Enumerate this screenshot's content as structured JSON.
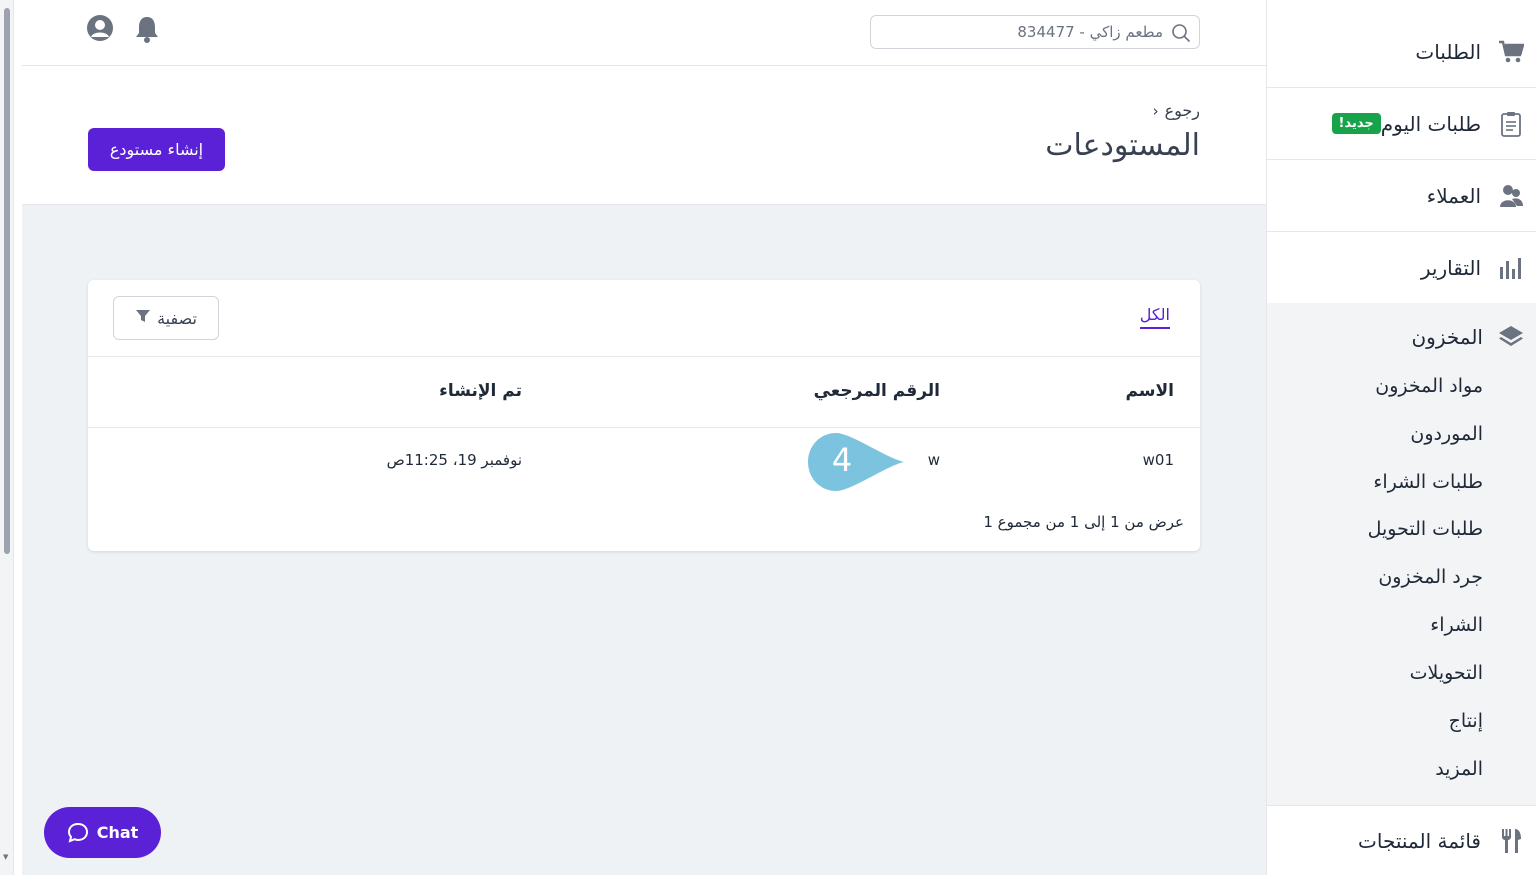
{
  "topbar": {
    "search_placeholder": "مطعم زاكي - 834477",
    "search_icon": "search-icon",
    "bell_icon": "bell-icon",
    "user_icon": "user-circle-icon"
  },
  "header": {
    "back_label": "رجوع",
    "title": "المستودعات",
    "create_button": "إنشاء مستودع"
  },
  "card": {
    "tab_all": "الكل",
    "filter_label": "تصفية",
    "columns": {
      "name": "الاسم",
      "ref": "الرقم المرجعي",
      "created": "تم الإنشاء"
    },
    "rows": [
      {
        "name": "w01",
        "ref": "w",
        "created": "نوفمبر 19، 11:25ص"
      }
    ],
    "pagination": "عرض من 1 إلى 1 من مجموع 1"
  },
  "bubble": {
    "number": "4",
    "color": "#7cc3df"
  },
  "chat": {
    "label": "Chat"
  },
  "sidebar": {
    "orders": "الطلبات",
    "today_orders": "طلبات اليوم",
    "new_badge": "جديد!",
    "customers": "العملاء",
    "reports": "التقارير",
    "inventory": "المخزون",
    "inventory_items": [
      "مواد المخزون",
      "الموردون",
      "طلبات الشراء",
      "طلبات التحويل",
      "جرد المخزون",
      "الشراء",
      "التحويلات",
      "إنتاج",
      "المزيد"
    ],
    "menu": "قائمة المنتجات"
  },
  "colors": {
    "accent": "#5b21d6",
    "badge": "#16a34a",
    "icon": "#6b7280"
  }
}
